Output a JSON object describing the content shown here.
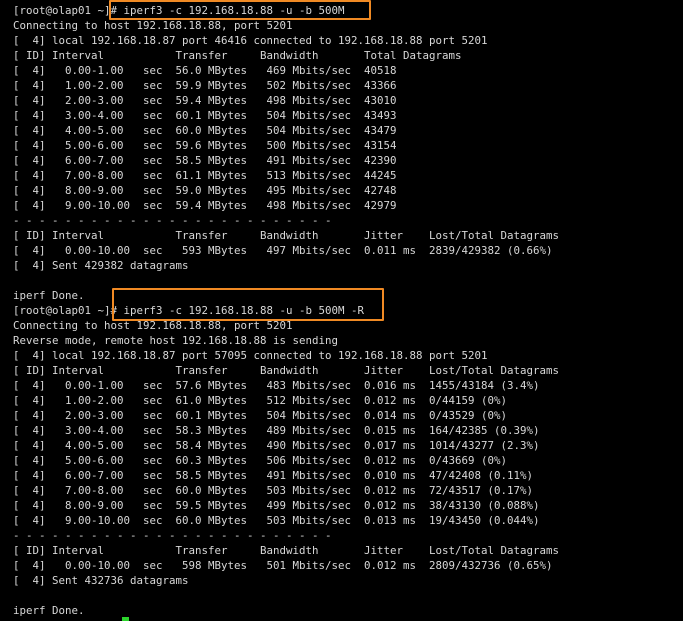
{
  "terminal": {
    "lines": [
      "[root@olap01 ~]# iperf3 -c 192.168.18.88 -u -b 500M",
      "Connecting to host 192.168.18.88, port 5201",
      "[  4] local 192.168.18.87 port 46416 connected to 192.168.18.88 port 5201",
      "[ ID] Interval           Transfer     Bandwidth       Total Datagrams",
      "[  4]   0.00-1.00   sec  56.0 MBytes   469 Mbits/sec  40518",
      "[  4]   1.00-2.00   sec  59.9 MBytes   502 Mbits/sec  43366",
      "[  4]   2.00-3.00   sec  59.4 MBytes   498 Mbits/sec  43010",
      "[  4]   3.00-4.00   sec  60.1 MBytes   504 Mbits/sec  43493",
      "[  4]   4.00-5.00   sec  60.0 MBytes   504 Mbits/sec  43479",
      "[  4]   5.00-6.00   sec  59.6 MBytes   500 Mbits/sec  43154",
      "[  4]   6.00-7.00   sec  58.5 MBytes   491 Mbits/sec  42390",
      "[  4]   7.00-8.00   sec  61.1 MBytes   513 Mbits/sec  44245",
      "[  4]   8.00-9.00   sec  59.0 MBytes   495 Mbits/sec  42748",
      "[  4]   9.00-10.00  sec  59.4 MBytes   498 Mbits/sec  42979",
      "- - - - - - - - - - - - - - - - - - - - - - - - -",
      "[ ID] Interval           Transfer     Bandwidth       Jitter    Lost/Total Datagrams",
      "[  4]   0.00-10.00  sec   593 MBytes   497 Mbits/sec  0.011 ms  2839/429382 (0.66%)",
      "[  4] Sent 429382 datagrams",
      "",
      "iperf Done.",
      "[root@olap01 ~]# iperf3 -c 192.168.18.88 -u -b 500M -R",
      "Connecting to host 192.168.18.88, port 5201",
      "Reverse mode, remote host 192.168.18.88 is sending",
      "[  4] local 192.168.18.87 port 57095 connected to 192.168.18.88 port 5201",
      "[ ID] Interval           Transfer     Bandwidth       Jitter    Lost/Total Datagrams",
      "[  4]   0.00-1.00   sec  57.6 MBytes   483 Mbits/sec  0.016 ms  1455/43184 (3.4%)",
      "[  4]   1.00-2.00   sec  61.0 MBytes   512 Mbits/sec  0.012 ms  0/44159 (0%)",
      "[  4]   2.00-3.00   sec  60.1 MBytes   504 Mbits/sec  0.014 ms  0/43529 (0%)",
      "[  4]   3.00-4.00   sec  58.3 MBytes   489 Mbits/sec  0.015 ms  164/42385 (0.39%)",
      "[  4]   4.00-5.00   sec  58.4 MBytes   490 Mbits/sec  0.017 ms  1014/43277 (2.3%)",
      "[  4]   5.00-6.00   sec  60.3 MBytes   506 Mbits/sec  0.012 ms  0/43669 (0%)",
      "[  4]   6.00-7.00   sec  58.5 MBytes   491 Mbits/sec  0.010 ms  47/42408 (0.11%)",
      "[  4]   7.00-8.00   sec  60.0 MBytes   503 Mbits/sec  0.012 ms  72/43517 (0.17%)",
      "[  4]   8.00-9.00   sec  59.5 MBytes   499 Mbits/sec  0.012 ms  38/43130 (0.088%)",
      "[  4]   9.00-10.00  sec  60.0 MBytes   503 Mbits/sec  0.013 ms  19/43450 (0.044%)",
      "- - - - - - - - - - - - - - - - - - - - - - - - -",
      "[ ID] Interval           Transfer     Bandwidth       Jitter    Lost/Total Datagrams",
      "[  4]   0.00-10.00  sec   598 MBytes   501 Mbits/sec  0.012 ms  2809/432736 (0.65%)",
      "[  4] Sent 432736 datagrams",
      "",
      "iperf Done."
    ]
  },
  "colors": {
    "background": "#000000",
    "text": "#d8d8d8",
    "highlight": "#f08a24",
    "cursor": "#2bd42b"
  }
}
